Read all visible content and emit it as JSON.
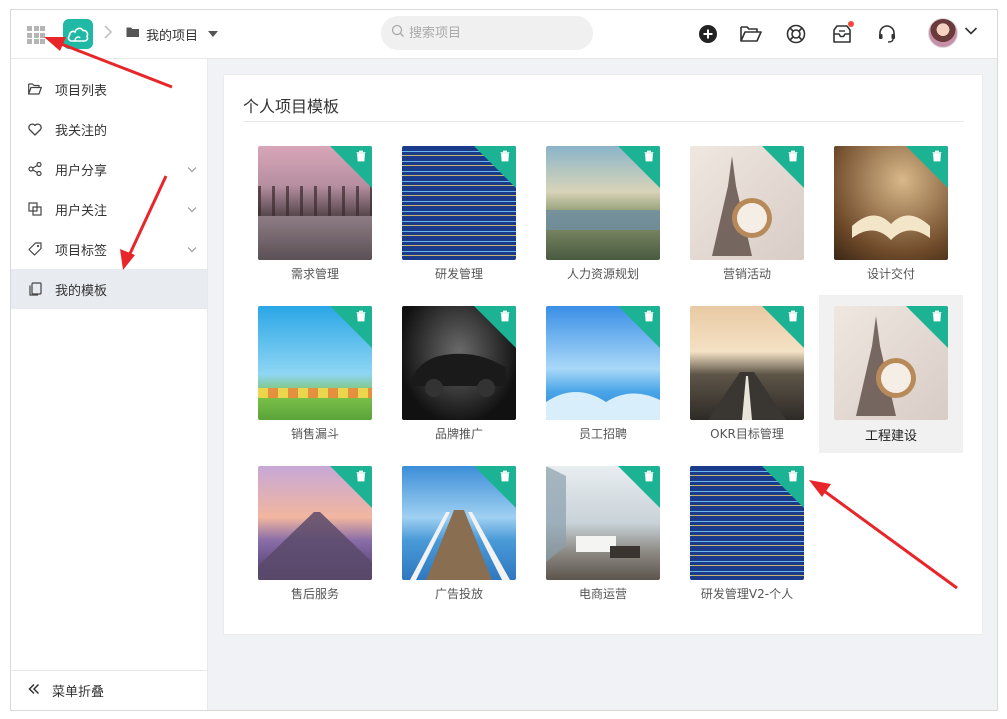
{
  "header": {
    "breadcrumb_project": "我的项目",
    "search_placeholder": "搜索项目",
    "icons": [
      "apps-grid-icon",
      "cloud-logo-icon",
      "chevron-right-icon",
      "folder-icon",
      "caret-down-icon",
      "search-icon",
      "add-circle-icon",
      "folder-open-icon",
      "help-circle-icon",
      "inbox-icon",
      "headset-icon",
      "avatar",
      "chevron-down-icon"
    ]
  },
  "sidebar": {
    "items": [
      {
        "label": "项目列表",
        "icon": "folder-open-icon"
      },
      {
        "label": "我关注的",
        "icon": "heart-icon"
      },
      {
        "label": "用户分享",
        "icon": "share-icon"
      },
      {
        "label": "用户关注",
        "icon": "copy-icon"
      },
      {
        "label": "项目标签",
        "icon": "tag-icon"
      },
      {
        "label": "我的模板",
        "icon": "template-icon"
      }
    ],
    "collapse_label": "菜单折叠"
  },
  "main": {
    "title": "个人项目模板",
    "templates": [
      {
        "label": "需求管理"
      },
      {
        "label": "研发管理"
      },
      {
        "label": "人力资源规划"
      },
      {
        "label": "营销活动"
      },
      {
        "label": "设计交付"
      },
      {
        "label": "销售漏斗"
      },
      {
        "label": "品牌推广"
      },
      {
        "label": "员工招聘"
      },
      {
        "label": "OKR目标管理"
      },
      {
        "label": "工程建设"
      },
      {
        "label": "售后服务"
      },
      {
        "label": "广告投放"
      },
      {
        "label": "电商运营"
      },
      {
        "label": "研发管理V2-个人"
      }
    ]
  },
  "colors": {
    "accent": "#1fb9a6",
    "delete_corner": "#1cb394",
    "notification_dot": "#f5483b",
    "annotation_arrow": "#e8262a"
  }
}
